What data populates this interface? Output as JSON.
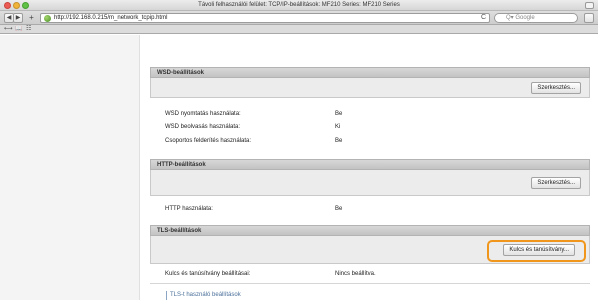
{
  "window": {
    "title": "Távoli felhasználói felület: TCP/IP-beállítások: MF210 Series: MF210 Series"
  },
  "toolbar": {
    "back": "◀",
    "forward": "▶",
    "add": "+",
    "url": "http://192.168.0.215/m_network_tcpip.html",
    "reload": "C",
    "search_placeholder": "Q▾ Google"
  },
  "bookmarks": [
    "⟷",
    "📖",
    "☷"
  ],
  "sections": {
    "wsd": {
      "title": "WSD-beállítások",
      "edit_label": "Szerkesztés...",
      "rows": [
        {
          "label": "WSD nyomtatás használata:",
          "value": "Be"
        },
        {
          "label": "WSD beolvasás használata:",
          "value": "Ki"
        },
        {
          "label": "Csoportos felderítés használata:",
          "value": "Be"
        }
      ]
    },
    "http": {
      "title": "HTTP-beállítások",
      "edit_label": "Szerkesztés...",
      "rows": [
        {
          "label": "HTTP használata:",
          "value": "Be"
        }
      ]
    },
    "tls": {
      "title": "TLS-beállítások",
      "key_button_label": "Kulcs és tanúsítvány...",
      "rows": [
        {
          "label": "Kulcs és tanúsítvány beállításai:",
          "value": "Nincs beállítva."
        }
      ],
      "link_label": "TLS-t használó beállítások"
    }
  },
  "colors": {
    "highlight": "#f0961c",
    "section_header": "#c8c8c8",
    "link": "#4a6f9a"
  }
}
